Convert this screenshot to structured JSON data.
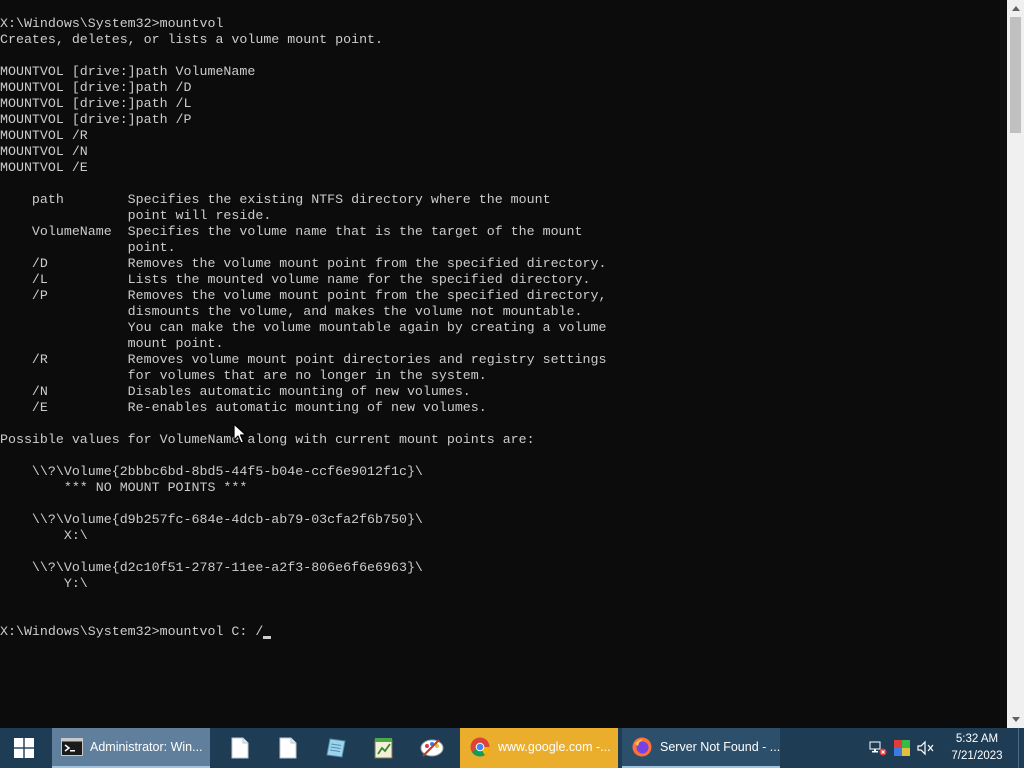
{
  "console": {
    "lines": [
      "X:\\Windows\\System32>mountvol",
      "Creates, deletes, or lists a volume mount point.",
      "",
      "MOUNTVOL [drive:]path VolumeName",
      "MOUNTVOL [drive:]path /D",
      "MOUNTVOL [drive:]path /L",
      "MOUNTVOL [drive:]path /P",
      "MOUNTVOL /R",
      "MOUNTVOL /N",
      "MOUNTVOL /E",
      "",
      "    path        Specifies the existing NTFS directory where the mount",
      "                point will reside.",
      "    VolumeName  Specifies the volume name that is the target of the mount",
      "                point.",
      "    /D          Removes the volume mount point from the specified directory.",
      "    /L          Lists the mounted volume name for the specified directory.",
      "    /P          Removes the volume mount point from the specified directory,",
      "                dismounts the volume, and makes the volume not mountable.",
      "                You can make the volume mountable again by creating a volume",
      "                mount point.",
      "    /R          Removes volume mount point directories and registry settings",
      "                for volumes that are no longer in the system.",
      "    /N          Disables automatic mounting of new volumes.",
      "    /E          Re-enables automatic mounting of new volumes.",
      "",
      "Possible values for VolumeName along with current mount points are:",
      "",
      "    \\\\?\\Volume{2bbbc6bd-8bd5-44f5-b04e-ccf6e9012f1c}\\",
      "        *** NO MOUNT POINTS ***",
      "",
      "    \\\\?\\Volume{d9b257fc-684e-4dcb-ab79-03cfa2f6b750}\\",
      "        X:\\",
      "",
      "    \\\\?\\Volume{d2c10f51-2787-11ee-a2f3-806e6f6e6963}\\",
      "        Y:\\",
      "",
      ""
    ],
    "prompt": "X:\\Windows\\System32>",
    "current_input": "mountvol C: /"
  },
  "taskbar": {
    "start_icon": "windows-logo-icon",
    "tasks": {
      "cmd": {
        "label": "Administrator: Win...",
        "icon": "cmd-icon"
      },
      "chrome": {
        "label": "www.google.com -...",
        "icon": "chrome-icon"
      },
      "firefox": {
        "label": "Server Not Found - ...",
        "icon": "firefox-icon"
      }
    },
    "pinned": [
      "document-icon",
      "document-icon",
      "notepad-icon",
      "spreadsheet-icon",
      "paint-icon"
    ],
    "tray": [
      "network-icon",
      "color-icon",
      "volume-muted-icon"
    ],
    "clock": {
      "time": "5:32 AM",
      "date": "7/21/2023"
    }
  },
  "colors": {
    "console_bg": "#0c0c0c",
    "console_fg": "#cccccc",
    "taskbar_bg": "#1f3c55",
    "chrome_task_bg": "#eaae2c"
  }
}
